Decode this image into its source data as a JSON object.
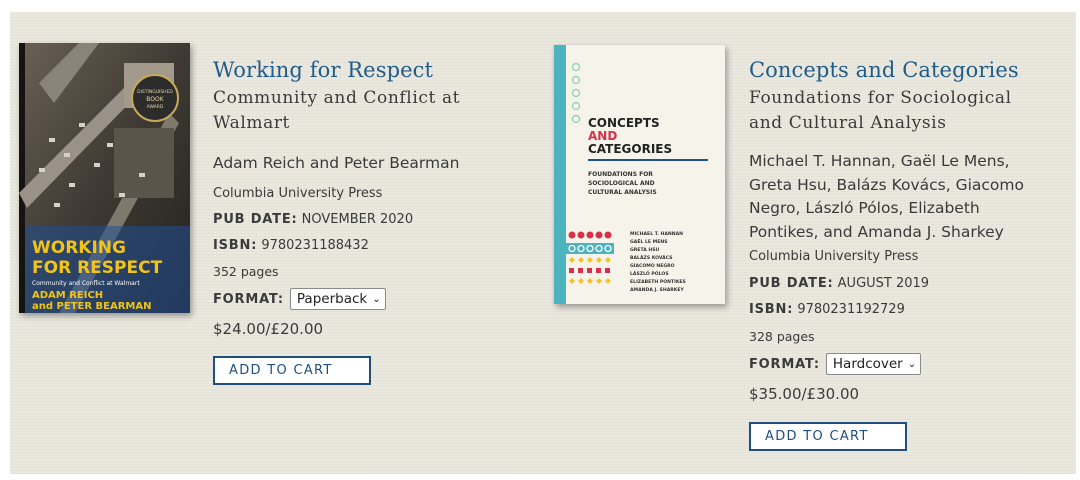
{
  "books": [
    {
      "title": "Working for Respect",
      "subtitle": "Community and Conflict at Walmart",
      "authors": "Adam Reich and Peter Bearman",
      "publisher": "Columbia University Press",
      "pub_date_label": "PUB DATE:",
      "pub_date": "NOVEMBER 2020",
      "isbn_label": "ISBN:",
      "isbn": "9780231188432",
      "pages": "352 pages",
      "format_label": "FORMAT:",
      "format_value": "Paperback",
      "price": "$24.00/£20.00",
      "cart_label": "ADD TO CART",
      "cover": {
        "title_line1": "WORKING",
        "title_line2": "FOR RESPECT",
        "subtitle": "Community and Conflict at Walmart",
        "author_line1": "ADAM REICH",
        "author_line2": "and PETER BEARMAN",
        "badge_line1": "DISTINGUISHED",
        "badge_line2": "BOOK",
        "badge_line3": "AWARD"
      }
    },
    {
      "title": "Concepts and Categories",
      "subtitle": "Foundations for Sociological and Cultural Analysis",
      "authors": "Michael T. Hannan, Gaël Le Mens, Greta Hsu, Balázs Kovács, Giacomo Negro, László Pólos, Elizabeth Pontikes, and Amanda J. Sharkey",
      "publisher": "Columbia University Press",
      "pub_date_label": "PUB DATE:",
      "pub_date": "AUGUST 2019",
      "isbn_label": "ISBN:",
      "isbn": "9780231192729",
      "pages": "328 pages",
      "format_label": "FORMAT:",
      "format_value": "Hardcover",
      "price": "$35.00/£30.00",
      "cart_label": "ADD TO CART",
      "cover": {
        "title_line1": "CONCEPTS",
        "title_line2": "AND",
        "title_line3": "CATEGORIES",
        "sub_line1": "FOUNDATIONS FOR",
        "sub_line2": "SOCIOLOGICAL AND",
        "sub_line3": "CULTURAL ANALYSIS",
        "author_names": [
          "MICHAEL T. HANNAN",
          "GAËL LE MENS",
          "GRETA HSU",
          "BALÁZS KOVÁCS",
          "GIACOMO NEGRO",
          "LÁSZLÓ PÓLOS",
          "ELIZABETH PONTIKES",
          "AMANDA J. SHARKEY"
        ]
      }
    }
  ],
  "colors": {
    "title_link": "#1f5c8a",
    "button_border": "#1f4f7f",
    "panel_bg": "#e9e6dc",
    "cover2_teal": "#4bb4bf",
    "cover2_red": "#d8304a",
    "cover2_yellow": "#f3c32a"
  }
}
